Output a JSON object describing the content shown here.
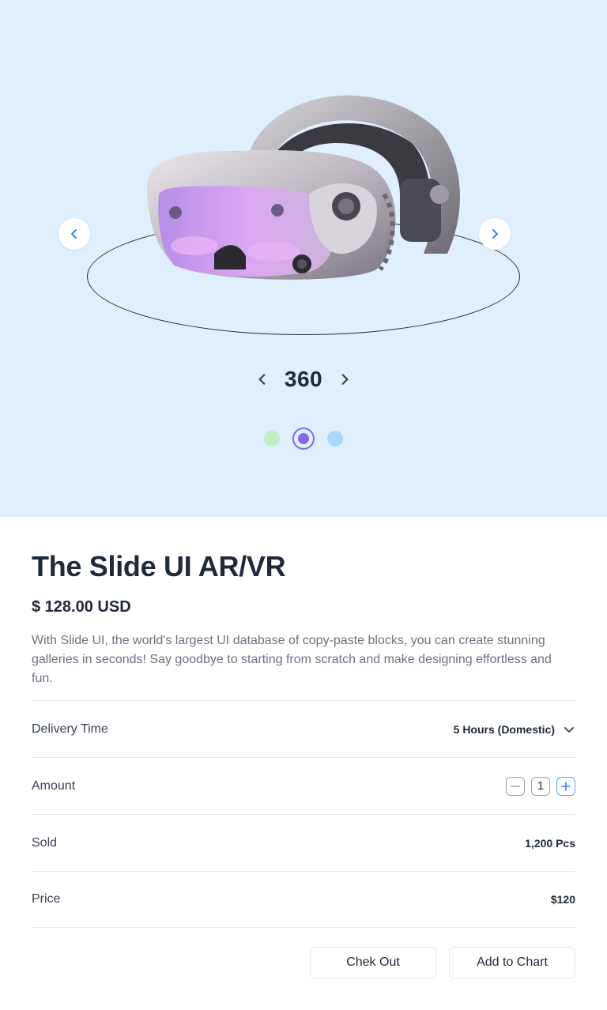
{
  "carousel": {
    "prev_icon": "chevron-left-icon",
    "next_icon": "chevron-right-icon",
    "view_label": "360",
    "variant_colors": [
      "#bcefc3",
      "#8a66e8",
      "#a8d8fb"
    ],
    "selected_variant": 2
  },
  "product": {
    "title": "The Slide UI AR/VR",
    "price": "$ 128.00 USD",
    "description": "With Slide UI, the world's largest UI database of copy-paste blocks, you can create stunning galleries in seconds! Say goodbye to starting from scratch and make designing effortless and fun."
  },
  "details": {
    "delivery": {
      "label": "Delivery Time",
      "value": "5 Hours (Domestic)"
    },
    "amount": {
      "label": "Amount",
      "value": "1"
    },
    "sold": {
      "label": "Sold",
      "value": "1,200 Pcs"
    },
    "price": {
      "label": "Price",
      "value": "$120"
    }
  },
  "actions": {
    "checkout_label": "Chek Out",
    "cart_label": "Add to Chart"
  },
  "colors": {
    "hero_bg": "#dfeffe",
    "accent_blue": "#3b82f6",
    "accent_purple": "#8a66e8"
  }
}
